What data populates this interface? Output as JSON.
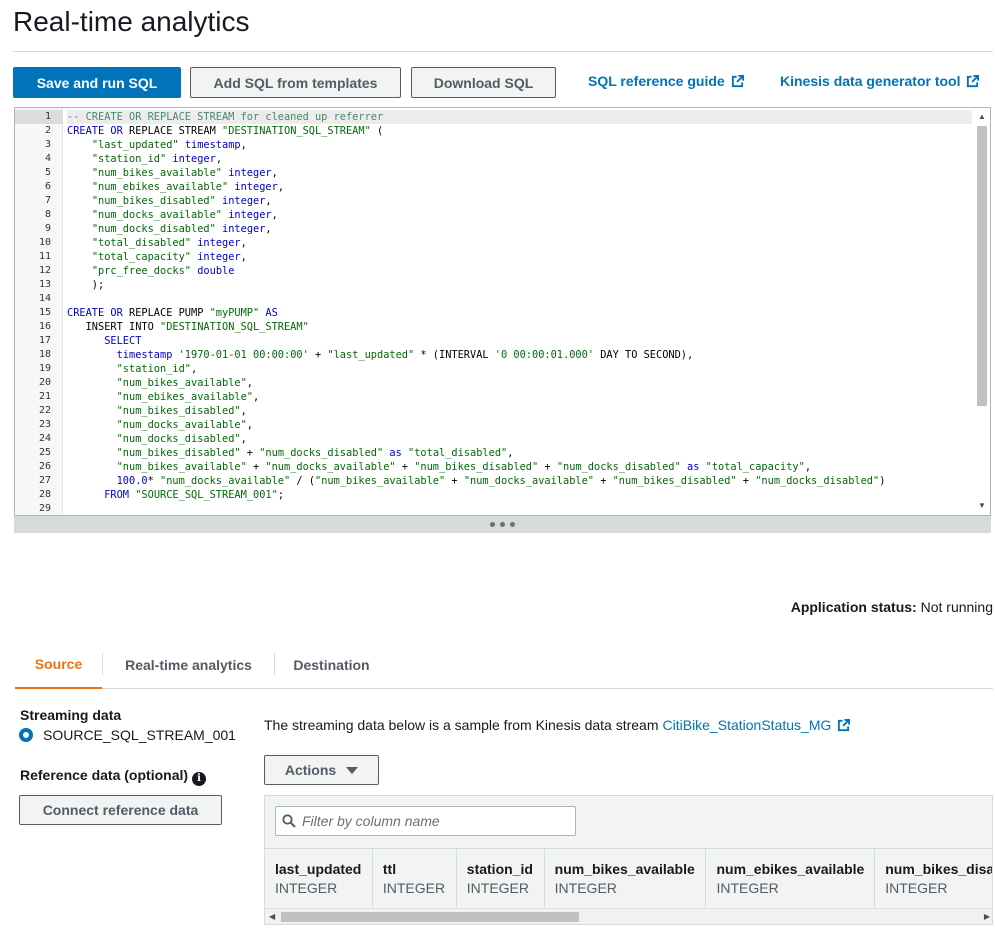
{
  "page": {
    "title": "Real-time analytics"
  },
  "toolbar": {
    "save_run_label": "Save and run SQL",
    "add_templates_label": "Add SQL from templates",
    "download_label": "Download SQL",
    "sql_reference_label": "SQL reference guide",
    "kinesis_generator_label": "Kinesis data generator tool"
  },
  "editor": {
    "line_numbers": [
      "1",
      "2",
      "3",
      "4",
      "5",
      "6",
      "7",
      "8",
      "9",
      "10",
      "11",
      "12",
      "13",
      "14",
      "15",
      "16",
      "17",
      "18",
      "19",
      "20",
      "21",
      "22",
      "23",
      "24",
      "25",
      "26",
      "27",
      "28",
      "29"
    ],
    "active_line": 1
  },
  "status": {
    "label": "Application status:",
    "value": "Not running"
  },
  "tabs": [
    {
      "label": "Source",
      "active": true
    },
    {
      "label": "Real-time analytics",
      "active": false
    },
    {
      "label": "Destination",
      "active": false
    }
  ],
  "source": {
    "streaming_label": "Streaming data",
    "stream_name": "SOURCE_SQL_STREAM_001",
    "reference_label": "Reference data (optional)",
    "connect_label": "Connect reference data",
    "description": "The streaming data below is a sample from Kinesis data stream",
    "stream_link": "CitiBike_StationStatus_MG",
    "actions_label": "Actions",
    "filter_placeholder": "Filter by column name",
    "columns": [
      {
        "name": "last_updated",
        "type": "INTEGER"
      },
      {
        "name": "ttl",
        "type": "INTEGER"
      },
      {
        "name": "station_id",
        "type": "INTEGER"
      },
      {
        "name": "num_bikes_available",
        "type": "INTEGER"
      },
      {
        "name": "num_ebikes_available",
        "type": "INTEGER"
      },
      {
        "name": "num_bikes_disa",
        "type": "INTEGER"
      }
    ]
  },
  "colors": {
    "primary": "#0073bb",
    "active_tab": "#ec7211",
    "link": "#0073bb"
  },
  "icons": {
    "external": "external-link-icon",
    "info": "info-icon",
    "search": "search-icon",
    "caret": "caret-down-icon"
  }
}
